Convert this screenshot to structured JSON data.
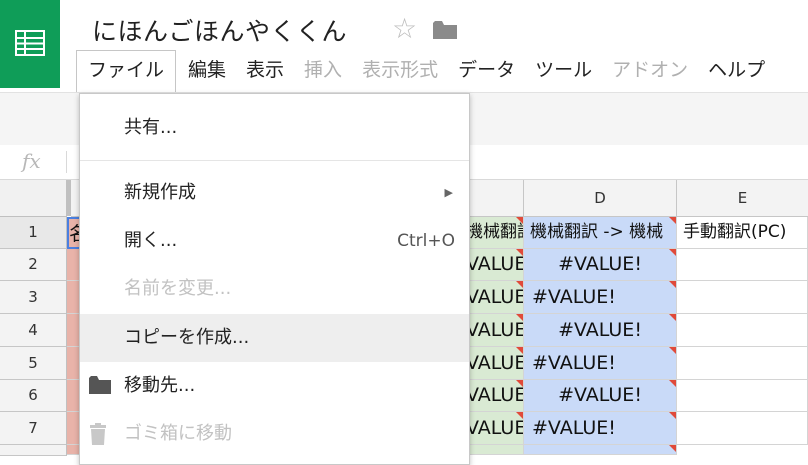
{
  "app": {
    "doc_title": "にほんごほんやくくん",
    "icons": {
      "star": "star-icon",
      "folder": "folder-icon",
      "logo": "sheets-logo-icon"
    }
  },
  "menubar": [
    {
      "label": "ファイル",
      "disabled": false
    },
    {
      "label": "編集",
      "disabled": false
    },
    {
      "label": "表示",
      "disabled": false
    },
    {
      "label": "挿入",
      "disabled": true
    },
    {
      "label": "表示形式",
      "disabled": true
    },
    {
      "label": "データ",
      "disabled": false
    },
    {
      "label": "ツール",
      "disabled": false
    },
    {
      "label": "アドオン",
      "disabled": true
    },
    {
      "label": "ヘルプ",
      "disabled": false
    }
  ],
  "formula_bar": {
    "fx": "fx"
  },
  "columns": [
    "D",
    "E"
  ],
  "rows": [
    "1",
    "2",
    "3",
    "4",
    "5",
    "6",
    "7"
  ],
  "cells": {
    "a1_partial": "名",
    "c1": "機械翻訳",
    "d1": "機械翻訳 -> 機械",
    "e1": "手動翻訳(PC)",
    "c_value": "VALUE!",
    "d_value": "#VALUE!"
  },
  "file_menu": {
    "share": "共有...",
    "new": "新規作成",
    "open": "開く...",
    "open_shortcut": "Ctrl+O",
    "rename": "名前を変更...",
    "copy": "コピーを作成...",
    "move": "移動先...",
    "trash": "ゴミ箱に移動"
  },
  "colors": {
    "brand": "#0f9d58",
    "pink": "#e8b3a9",
    "green": "#d9ead3",
    "blue": "#c9daf8"
  }
}
